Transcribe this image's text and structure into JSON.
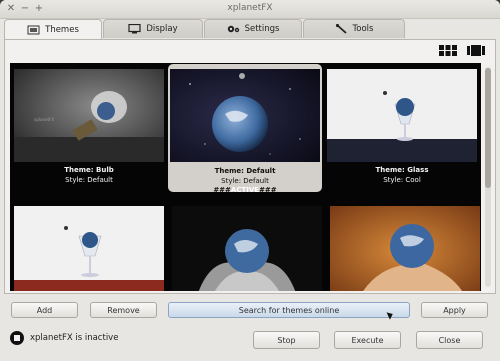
{
  "window": {
    "title": "xplanetFX"
  },
  "tabs": [
    {
      "label": "Themes",
      "icon": "themes-icon",
      "active": true
    },
    {
      "label": "Display",
      "icon": "monitor-icon",
      "active": false
    },
    {
      "label": "Settings",
      "icon": "settings-icon",
      "active": false
    },
    {
      "label": "Tools",
      "icon": "tools-icon",
      "active": false
    }
  ],
  "view_icons": [
    "grid-view-icon",
    "list-view-icon"
  ],
  "themes": [
    {
      "name": "Theme: Bulb",
      "style": "Style: Default",
      "active": false
    },
    {
      "name": "Theme: Default",
      "style": "Style: Default",
      "active": true,
      "active_label_prefix": "###",
      "active_label": "ACTIVE",
      "active_label_suffix": "###"
    },
    {
      "name": "Theme: Glass",
      "style": "Style: Cool",
      "active": false
    }
  ],
  "buttons": {
    "add": "Add",
    "remove": "Remove",
    "search": "Search for themes online",
    "apply": "Apply",
    "stop": "Stop",
    "execute": "Execute",
    "close": "Close"
  },
  "status": {
    "text": "xplanetFX is inactive"
  },
  "colors": {
    "accent_blue": "#c9d9ea",
    "gallery_bg": "#050505",
    "selected_bg": "#d3cfca"
  }
}
